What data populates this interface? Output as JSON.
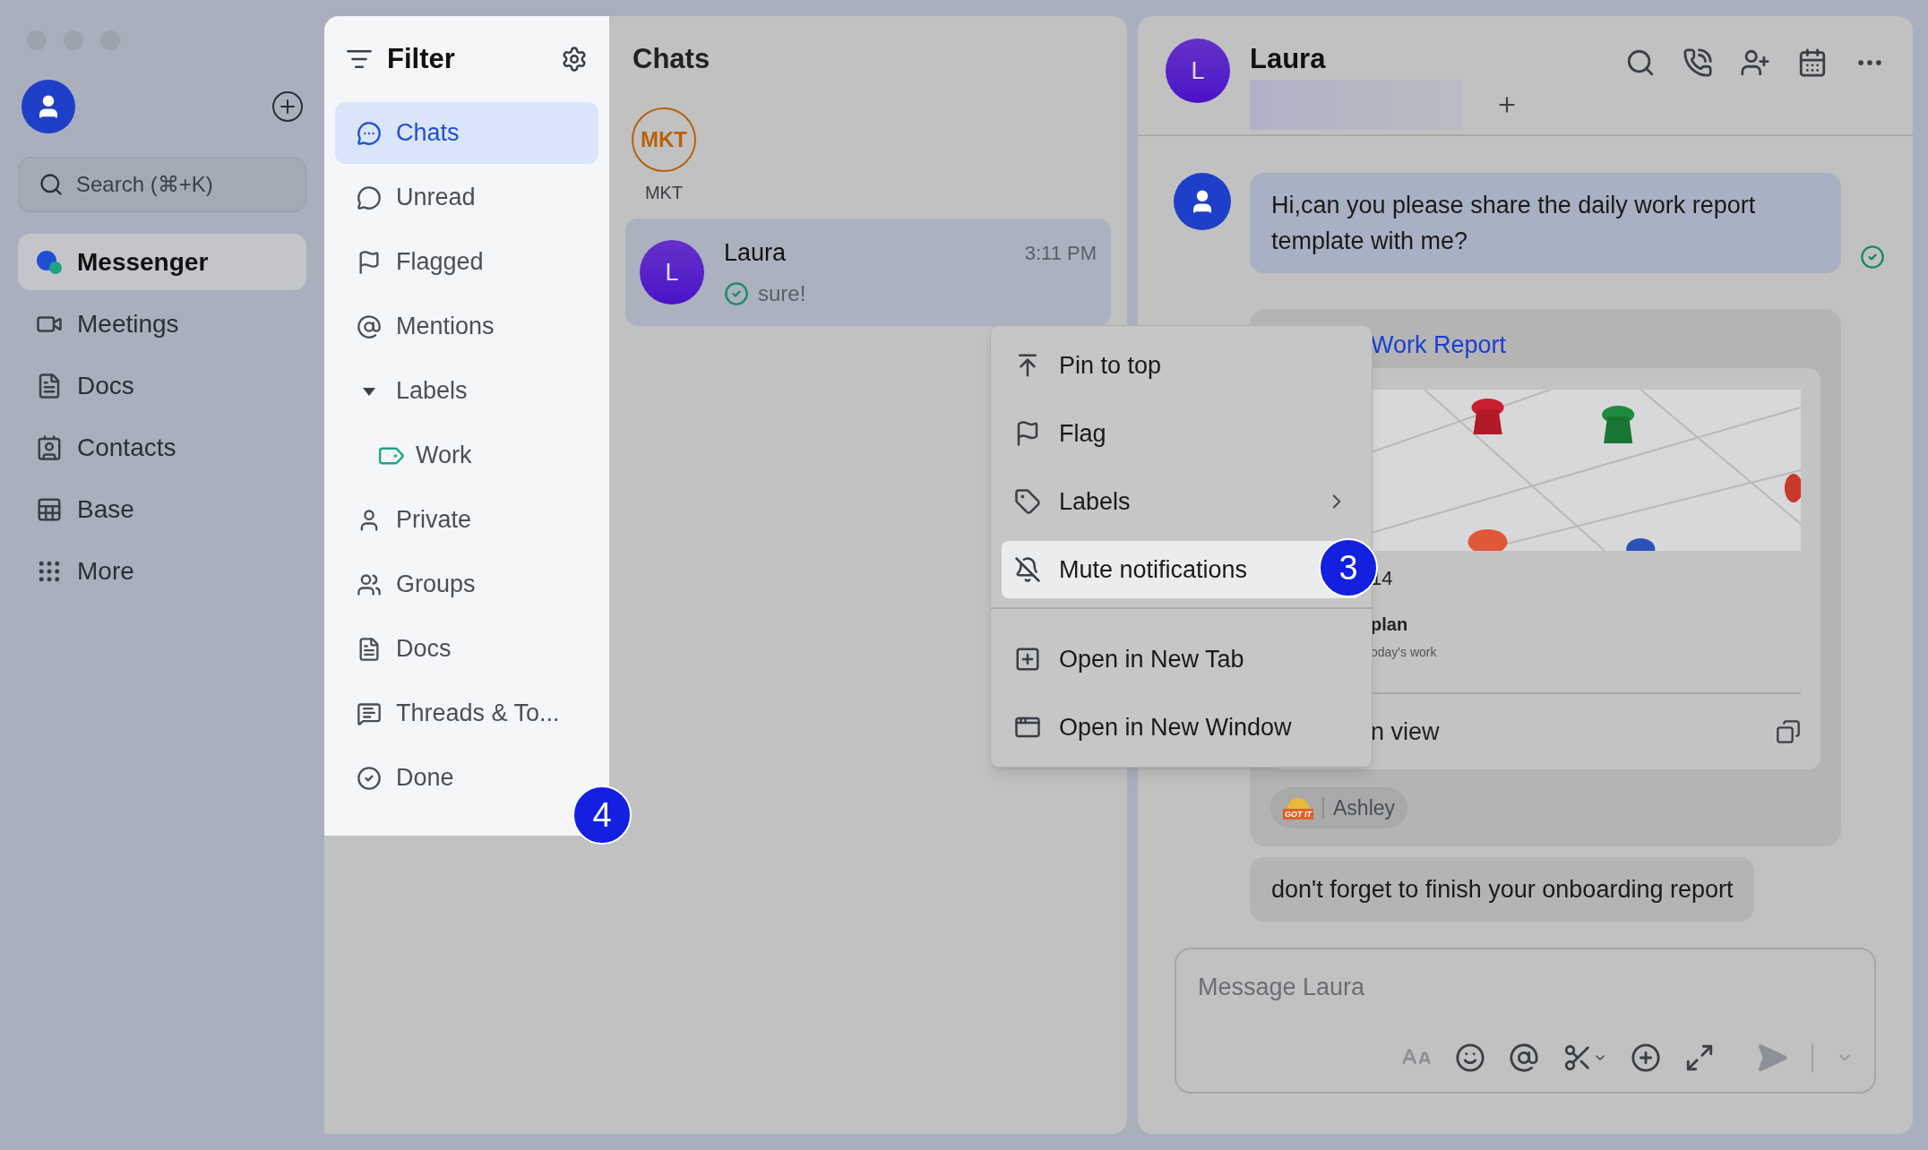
{
  "nav": {
    "search": {
      "placeholder": "Search (⌘+K)"
    },
    "items": [
      {
        "label": "Messenger",
        "selected": true
      },
      {
        "label": "Meetings",
        "selected": false
      },
      {
        "label": "Docs",
        "selected": false
      },
      {
        "label": "Contacts",
        "selected": false
      },
      {
        "label": "Base",
        "selected": false
      },
      {
        "label": "More",
        "selected": false
      }
    ]
  },
  "filter": {
    "title": "Filter",
    "items": [
      {
        "label": "Chats",
        "selected": true
      },
      {
        "label": "Unread",
        "selected": false
      },
      {
        "label": "Flagged",
        "selected": false
      },
      {
        "label": "Mentions",
        "selected": false
      },
      {
        "label": "Labels",
        "selected": false,
        "expanded": true,
        "children": [
          {
            "label": "Work",
            "selected": false
          }
        ]
      },
      {
        "label": "Private",
        "selected": false
      },
      {
        "label": "Groups",
        "selected": false
      },
      {
        "label": "Docs",
        "selected": false
      },
      {
        "label": "Threads & To...",
        "selected": false
      },
      {
        "label": "Done",
        "selected": false
      }
    ]
  },
  "chats": {
    "title": "Chats",
    "pinned": [
      {
        "initials": "MKT",
        "label": "MKT"
      }
    ],
    "conversations": [
      {
        "initials": "L",
        "name": "Laura",
        "time": "3:11 PM",
        "preview": "sure!",
        "read": true,
        "selected": true
      }
    ]
  },
  "conversation": {
    "initials": "L",
    "name": "Laura",
    "messages": [
      {
        "kind": "text",
        "text": "Hi,can you please share the daily work report template with me?",
        "read": true
      },
      {
        "kind": "card",
        "title": "Work Report",
        "lines": [
          "14",
          "plan",
          "oday's work"
        ],
        "footer": "n view",
        "reactions": [
          {
            "sticker": "GOT IT",
            "name": "Ashley"
          }
        ]
      },
      {
        "kind": "text",
        "text": "don't forget to finish your onboarding report"
      }
    ],
    "composer": {
      "placeholder": "Message Laura"
    }
  },
  "context_menu": {
    "sections": [
      [
        {
          "label": "Pin to top",
          "selected": false
        },
        {
          "label": "Flag",
          "selected": false
        },
        {
          "label": "Labels",
          "selected": false,
          "submenu": true
        },
        {
          "label": "Mute notifications",
          "selected": true
        }
      ],
      [
        {
          "label": "Open in New Tab",
          "selected": false
        },
        {
          "label": "Open in New Window",
          "selected": false
        }
      ]
    ]
  },
  "step_markers": [
    {
      "text": "3"
    },
    {
      "text": "4"
    }
  ]
}
